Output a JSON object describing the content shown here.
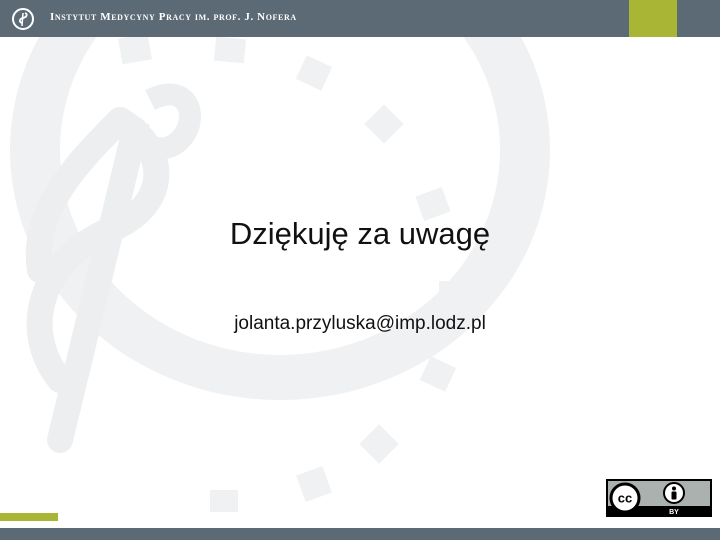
{
  "header": {
    "institute_name": "Instytut Medycyny Pracy im. prof. J. Nofera",
    "logo_icon": "caduceus-logo-icon",
    "bar_color": "#5c6a76",
    "accent_color": "#a8b535"
  },
  "slide": {
    "title": "Dziękuję za uwagę",
    "email": "jolanta.przyluska@imp.lodz.pl"
  },
  "license_badge": {
    "icon": "creative-commons-by-icon",
    "cc_label": "cc",
    "by_label": "BY"
  }
}
